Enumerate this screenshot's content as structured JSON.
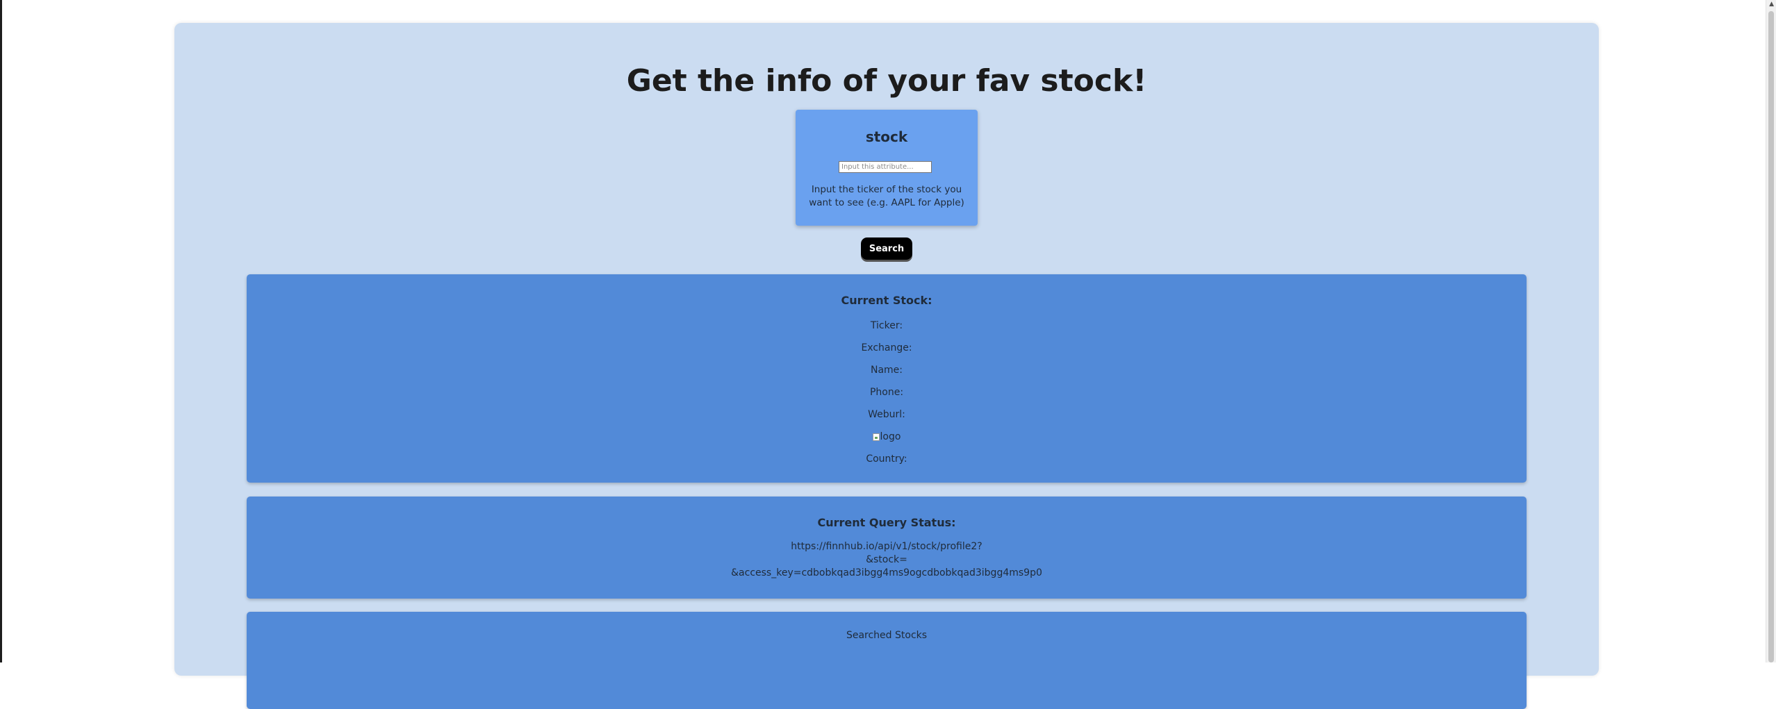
{
  "page": {
    "title": "Get the info of your fav stock!"
  },
  "attribute": {
    "name": "stock",
    "input_value": "",
    "input_placeholder": "Input this attribute...",
    "help_text": "Input the ticker of the stock you want to see (e.g. AAPL for Apple)"
  },
  "search_button": {
    "label": "Search"
  },
  "current_stock": {
    "heading": "Current Stock:",
    "fields": [
      {
        "label": "Ticker:",
        "value": ""
      },
      {
        "label": "Exchange:",
        "value": ""
      },
      {
        "label": "Name:",
        "value": ""
      },
      {
        "label": "Phone:",
        "value": ""
      },
      {
        "label": "Weburl:",
        "value": ""
      }
    ],
    "logo_alt": "logo",
    "country": {
      "label": "Country:",
      "value": ""
    }
  },
  "query_status": {
    "heading": "Current Query Status:",
    "lines": [
      "https://finnhub.io/api/v1/stock/profile2?",
      "&stock=",
      "&access_key=cdbobkqad3ibgg4ms9ogcdbobkqad3ibgg4ms9p0"
    ]
  },
  "searched_stocks": {
    "heading": "Searched Stocks"
  },
  "colors": {
    "container_bg": "#cbdcf1",
    "attribute_card_bg": "#6aa1ef",
    "info_card_bg": "#528ad8",
    "button_bg": "#000000"
  },
  "icons": {
    "broken_image": "broken-image-icon"
  }
}
